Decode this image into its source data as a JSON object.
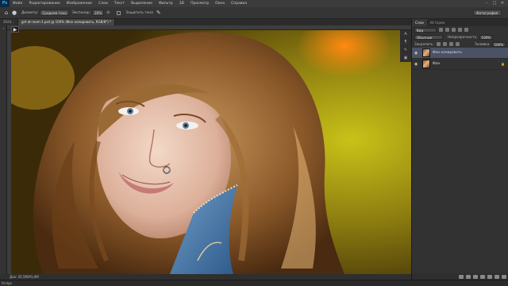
{
  "menu": {
    "logo": "Ps",
    "items": [
      "Файл",
      "Редактирование",
      "Изображение",
      "Слои",
      "Текст",
      "Выделение",
      "Фильтр",
      "3D",
      "Просмотр",
      "Окно",
      "Справка"
    ],
    "window_controls": [
      "–",
      "□",
      "✕"
    ]
  },
  "options": {
    "diameter_label": "Диаметр:",
    "mode_value": "Средняя тона",
    "exposure_label": "Экспонир:",
    "exposure_value": "20%",
    "protect_tones_label": "Защитить тона",
    "workspace_value": "Фотография"
  },
  "tabs": [
    {
      "label": "3024...",
      "active": false
    },
    {
      "label": "girl-at-room-1.psd @ 100% (Фон копировать, RGB/8*) *",
      "active": true
    }
  ],
  "status": {
    "text": "Док: 45,5M/91,0M",
    "bottom_left": "Bridge"
  },
  "panel": {
    "tabs": [
      {
        "label": "Слои",
        "active": true
      },
      {
        "label": "История",
        "active": false
      }
    ],
    "filter_value": "Вид",
    "blend_mode": "Обычные",
    "opacity_label": "Непрозрачность:",
    "opacity_value": "100%",
    "lock_label": "Закрепить:",
    "fill_label": "Заливка:",
    "fill_value": "100%",
    "layers": [
      {
        "name": "Фон копировать",
        "selected": true
      },
      {
        "name": "Фон",
        "selected": false
      }
    ]
  }
}
